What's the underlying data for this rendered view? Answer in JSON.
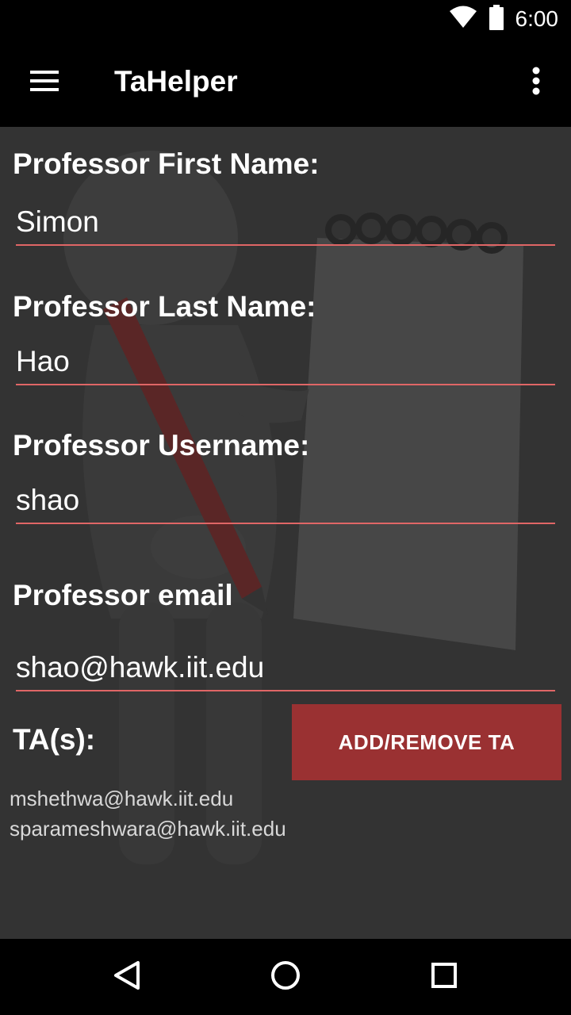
{
  "status_bar": {
    "time": "6:00",
    "icons": [
      "wifi-icon",
      "battery-icon"
    ]
  },
  "app_bar": {
    "title": "TaHelper",
    "menu_icon": "hamburger-menu-icon",
    "overflow_icon": "more-vert-icon"
  },
  "form": {
    "first_name": {
      "label": "Professor First Name:",
      "value": "Simon"
    },
    "last_name": {
      "label": "Professor Last Name:",
      "value": "Hao"
    },
    "username": {
      "label": "Professor Username:",
      "value": "shao"
    },
    "email": {
      "label": "Professor email",
      "value": "shao@hawk.iit.edu"
    }
  },
  "ta": {
    "label": "TA(s):",
    "button_label": "ADD/REMOVE TA",
    "items": [
      "mshethwa@hawk.iit.edu",
      "sparameshwara@hawk.iit.edu"
    ]
  },
  "colors": {
    "accent": "#9a3132",
    "underline": "#e06666",
    "content_bg": "#333333"
  },
  "nav_bar": {
    "icons": [
      "back-icon",
      "home-icon",
      "recents-icon"
    ]
  }
}
